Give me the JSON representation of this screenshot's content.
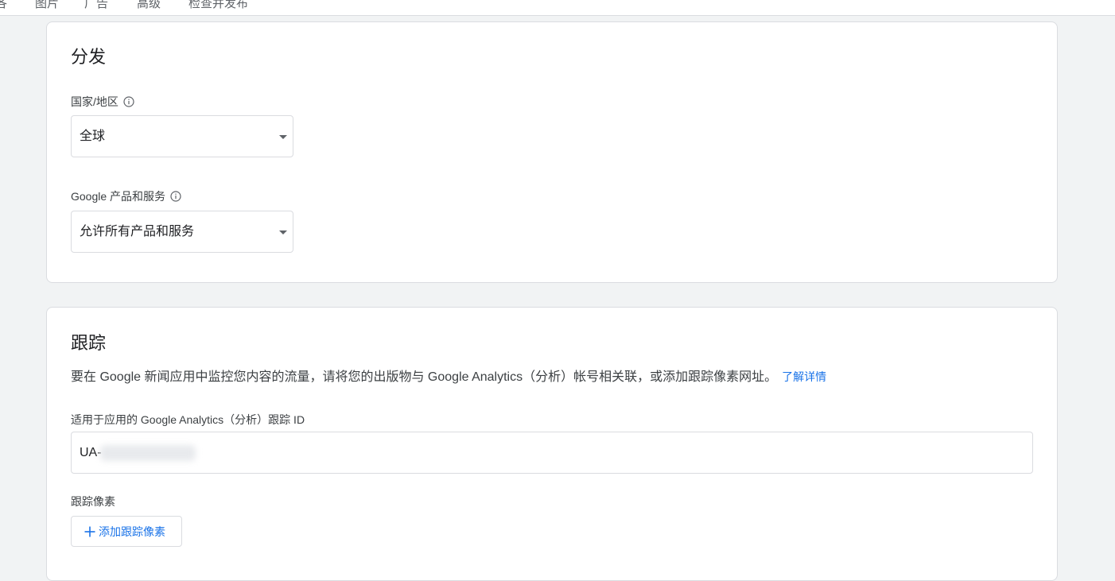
{
  "topbar": {
    "tabs": [
      "各",
      "图片",
      "广告",
      "高级",
      "检查并发布"
    ]
  },
  "distribution": {
    "title": "分发",
    "country": {
      "label": "国家/地区",
      "value": "全球"
    },
    "products": {
      "label": "Google 产品和服务",
      "value": "允许所有产品和服务"
    }
  },
  "tracking": {
    "title": "跟踪",
    "description": "要在 Google 新闻应用中监控您内容的流量，请将您的出版物与 Google Analytics（分析）帐号相关联，或添加跟踪像素网址。",
    "learn_more": "了解详情",
    "analytics_id": {
      "label": "适用于应用的 Google Analytics（分析）跟踪 ID",
      "prefix": "UA-"
    },
    "pixels": {
      "label": "跟踪像素",
      "add_button": "添加跟踪像素"
    }
  },
  "colors": {
    "accent": "#1a73e8",
    "background": "#f1f3f4",
    "border": "#dadce0"
  }
}
